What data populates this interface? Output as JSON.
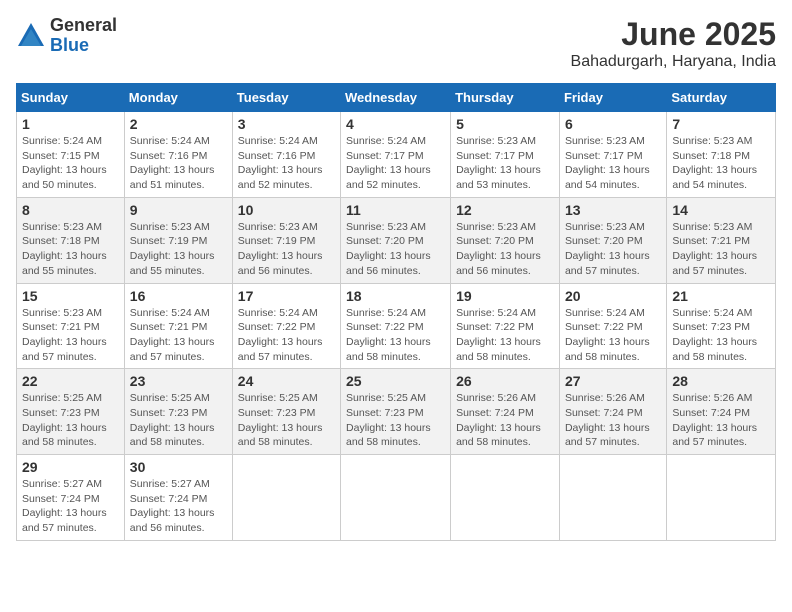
{
  "logo": {
    "general": "General",
    "blue": "Blue"
  },
  "title": "June 2025",
  "location": "Bahadurgarh, Haryana, India",
  "weekdays": [
    "Sunday",
    "Monday",
    "Tuesday",
    "Wednesday",
    "Thursday",
    "Friday",
    "Saturday"
  ],
  "weeks": [
    [
      {
        "day": "1",
        "info": "Sunrise: 5:24 AM\nSunset: 7:15 PM\nDaylight: 13 hours\nand 50 minutes."
      },
      {
        "day": "2",
        "info": "Sunrise: 5:24 AM\nSunset: 7:16 PM\nDaylight: 13 hours\nand 51 minutes."
      },
      {
        "day": "3",
        "info": "Sunrise: 5:24 AM\nSunset: 7:16 PM\nDaylight: 13 hours\nand 52 minutes."
      },
      {
        "day": "4",
        "info": "Sunrise: 5:24 AM\nSunset: 7:17 PM\nDaylight: 13 hours\nand 52 minutes."
      },
      {
        "day": "5",
        "info": "Sunrise: 5:23 AM\nSunset: 7:17 PM\nDaylight: 13 hours\nand 53 minutes."
      },
      {
        "day": "6",
        "info": "Sunrise: 5:23 AM\nSunset: 7:17 PM\nDaylight: 13 hours\nand 54 minutes."
      },
      {
        "day": "7",
        "info": "Sunrise: 5:23 AM\nSunset: 7:18 PM\nDaylight: 13 hours\nand 54 minutes."
      }
    ],
    [
      {
        "day": "8",
        "info": "Sunrise: 5:23 AM\nSunset: 7:18 PM\nDaylight: 13 hours\nand 55 minutes."
      },
      {
        "day": "9",
        "info": "Sunrise: 5:23 AM\nSunset: 7:19 PM\nDaylight: 13 hours\nand 55 minutes."
      },
      {
        "day": "10",
        "info": "Sunrise: 5:23 AM\nSunset: 7:19 PM\nDaylight: 13 hours\nand 56 minutes."
      },
      {
        "day": "11",
        "info": "Sunrise: 5:23 AM\nSunset: 7:20 PM\nDaylight: 13 hours\nand 56 minutes."
      },
      {
        "day": "12",
        "info": "Sunrise: 5:23 AM\nSunset: 7:20 PM\nDaylight: 13 hours\nand 56 minutes."
      },
      {
        "day": "13",
        "info": "Sunrise: 5:23 AM\nSunset: 7:20 PM\nDaylight: 13 hours\nand 57 minutes."
      },
      {
        "day": "14",
        "info": "Sunrise: 5:23 AM\nSunset: 7:21 PM\nDaylight: 13 hours\nand 57 minutes."
      }
    ],
    [
      {
        "day": "15",
        "info": "Sunrise: 5:23 AM\nSunset: 7:21 PM\nDaylight: 13 hours\nand 57 minutes."
      },
      {
        "day": "16",
        "info": "Sunrise: 5:24 AM\nSunset: 7:21 PM\nDaylight: 13 hours\nand 57 minutes."
      },
      {
        "day": "17",
        "info": "Sunrise: 5:24 AM\nSunset: 7:22 PM\nDaylight: 13 hours\nand 57 minutes."
      },
      {
        "day": "18",
        "info": "Sunrise: 5:24 AM\nSunset: 7:22 PM\nDaylight: 13 hours\nand 58 minutes."
      },
      {
        "day": "19",
        "info": "Sunrise: 5:24 AM\nSunset: 7:22 PM\nDaylight: 13 hours\nand 58 minutes."
      },
      {
        "day": "20",
        "info": "Sunrise: 5:24 AM\nSunset: 7:22 PM\nDaylight: 13 hours\nand 58 minutes."
      },
      {
        "day": "21",
        "info": "Sunrise: 5:24 AM\nSunset: 7:23 PM\nDaylight: 13 hours\nand 58 minutes."
      }
    ],
    [
      {
        "day": "22",
        "info": "Sunrise: 5:25 AM\nSunset: 7:23 PM\nDaylight: 13 hours\nand 58 minutes."
      },
      {
        "day": "23",
        "info": "Sunrise: 5:25 AM\nSunset: 7:23 PM\nDaylight: 13 hours\nand 58 minutes."
      },
      {
        "day": "24",
        "info": "Sunrise: 5:25 AM\nSunset: 7:23 PM\nDaylight: 13 hours\nand 58 minutes."
      },
      {
        "day": "25",
        "info": "Sunrise: 5:25 AM\nSunset: 7:23 PM\nDaylight: 13 hours\nand 58 minutes."
      },
      {
        "day": "26",
        "info": "Sunrise: 5:26 AM\nSunset: 7:24 PM\nDaylight: 13 hours\nand 58 minutes."
      },
      {
        "day": "27",
        "info": "Sunrise: 5:26 AM\nSunset: 7:24 PM\nDaylight: 13 hours\nand 57 minutes."
      },
      {
        "day": "28",
        "info": "Sunrise: 5:26 AM\nSunset: 7:24 PM\nDaylight: 13 hours\nand 57 minutes."
      }
    ],
    [
      {
        "day": "29",
        "info": "Sunrise: 5:27 AM\nSunset: 7:24 PM\nDaylight: 13 hours\nand 57 minutes."
      },
      {
        "day": "30",
        "info": "Sunrise: 5:27 AM\nSunset: 7:24 PM\nDaylight: 13 hours\nand 56 minutes."
      },
      {
        "day": "",
        "info": ""
      },
      {
        "day": "",
        "info": ""
      },
      {
        "day": "",
        "info": ""
      },
      {
        "day": "",
        "info": ""
      },
      {
        "day": "",
        "info": ""
      }
    ]
  ]
}
